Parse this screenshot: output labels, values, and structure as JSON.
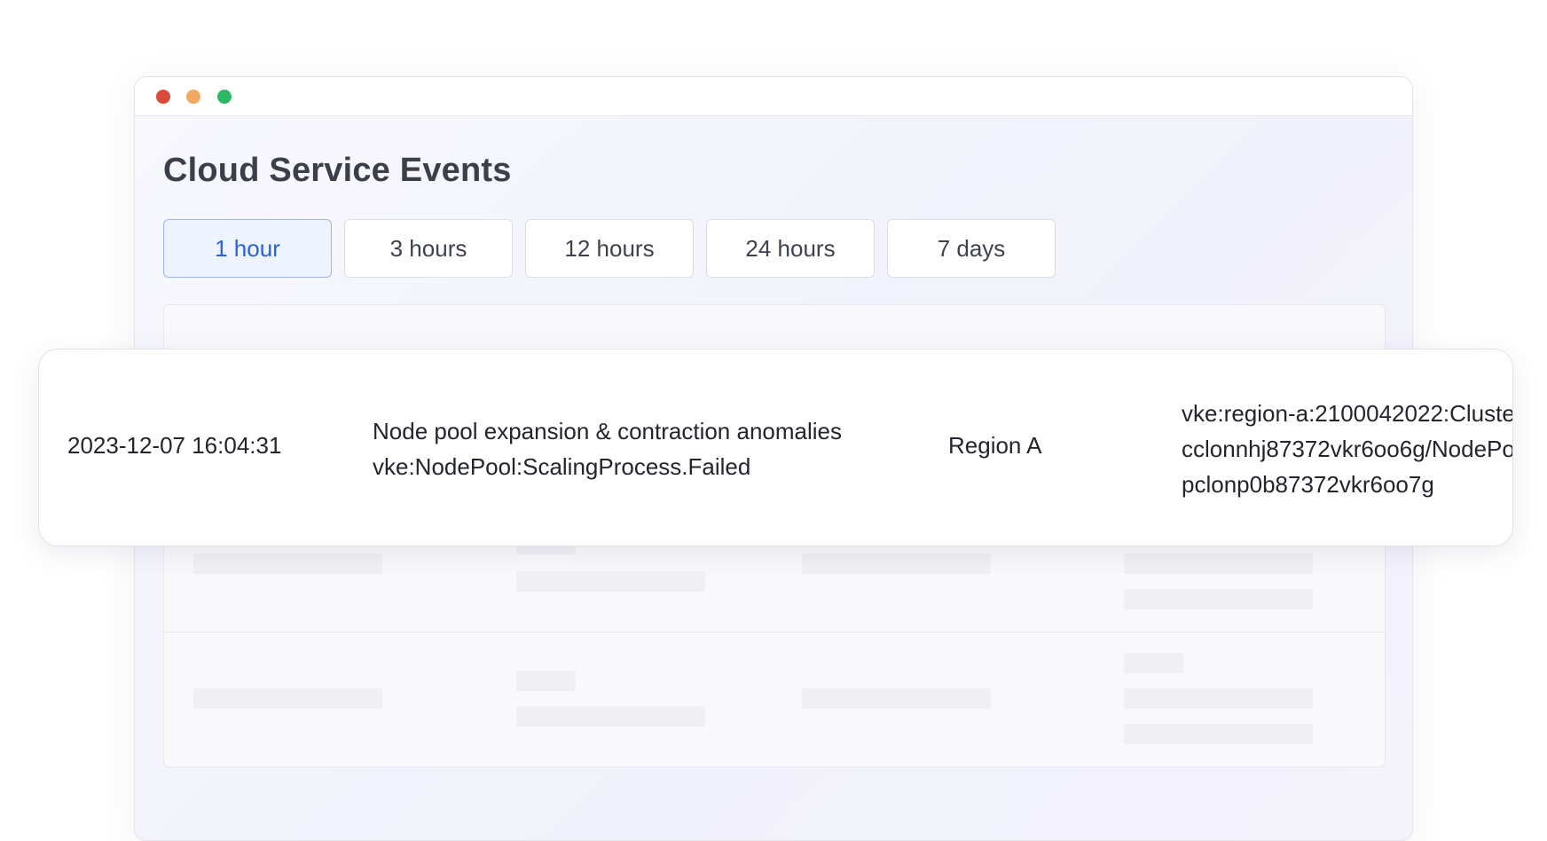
{
  "window": {
    "title": "Cloud Service Events",
    "controls": [
      "close",
      "minimize",
      "maximize"
    ]
  },
  "tabs": [
    {
      "label": "1 hour",
      "active": true
    },
    {
      "label": "3 hours",
      "active": false
    },
    {
      "label": "12 hours",
      "active": false
    },
    {
      "label": "24 hours",
      "active": false
    },
    {
      "label": "7 days",
      "active": false
    }
  ],
  "event": {
    "timestamp": "2023-12-07 16:04:31",
    "name": "Node pool expansion & contraction anomalies",
    "code": "vke:NodePool:ScalingProcess.Failed",
    "region": "Region A",
    "resource_lines": [
      "vke:region-a:2100042022:Cluste",
      "cclonnhj87372vkr6oo6g/NodePo",
      "pclonp0b87372vkr6oo7g"
    ]
  },
  "colors": {
    "accent": "#2b62d8",
    "close": "#d94a3d",
    "minimize": "#f4a861",
    "maximize": "#2cb865"
  }
}
